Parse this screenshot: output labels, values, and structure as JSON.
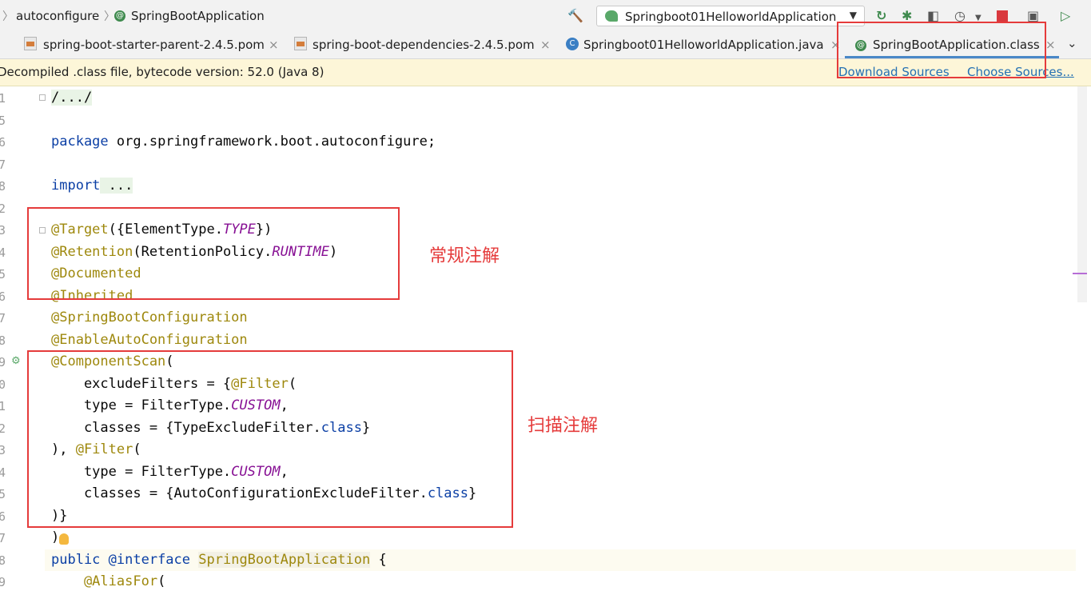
{
  "breadcrumb": {
    "items": [
      "autoconfigure",
      "SpringBootApplication"
    ]
  },
  "toolbar": {
    "run_config": "Springboot01HelloworldApplication",
    "icons": [
      "hammer-icon",
      "rerun-icon",
      "debug-icon",
      "coverage-icon",
      "profile-icon",
      "stop-icon",
      "project-structure-icon",
      "terminal-icon"
    ]
  },
  "tabs": [
    {
      "label": "spring-boot-starter-parent-2.4.5.pom",
      "close": "×",
      "icon": "maven-pom-icon"
    },
    {
      "label": "spring-boot-dependencies-2.4.5.pom",
      "close": "×",
      "icon": "maven-pom-icon"
    },
    {
      "label": "Springboot01HelloworldApplication.java",
      "close": "×",
      "icon": "java-class-icon"
    },
    {
      "label": "SpringBootApplication.class",
      "close": "×",
      "icon": "annotation-icon",
      "active": true
    }
  ],
  "banner": {
    "message": "Decompiled .class file, bytecode version: 52.0 (Java 8)",
    "download_sources": "Download Sources",
    "choose_sources": "Choose Sources..."
  },
  "gutter": {
    "line_numbers": [
      "1",
      "5",
      "6",
      "7",
      "8",
      "2",
      "3",
      "4",
      "5",
      "6",
      "7",
      "8",
      "9",
      "0",
      "1",
      "2",
      "3",
      "4",
      "5",
      "6",
      "7",
      "8",
      "9"
    ]
  },
  "code": {
    "l1": "/.../",
    "l2_kw": "package",
    "l2_rest": " org.springframework.boot.autoconfigure;",
    "l3_kw": "import",
    "l3_rest": " ...",
    "target_ann": "@Target",
    "target_a": "({ElementType.",
    "target_f": "TYPE",
    "target_b": "})",
    "retention_ann": "@Retention",
    "retention_a": "(RetentionPolicy.",
    "retention_f": "RUNTIME",
    "retention_b": ")",
    "documented": "@Documented",
    "inherited": "@Inherited",
    "sbc": "@SpringBootConfiguration",
    "eac": "@EnableAutoConfiguration",
    "cs_ann": "@ComponentScan",
    "cs_open": "(",
    "ef_a": "    excludeFilters = {",
    "ef_ann": "@Filter",
    "ef_b": "(",
    "type1_a": "    type = FilterType.",
    "type1_f": "CUSTOM",
    "type1_b": ",",
    "cls1_a": "    classes = {TypeExcludeFilter.",
    "cls1_kw": "class",
    "cls1_b": "}",
    "f2_a": "), ",
    "f2_ann": "@Filter",
    "f2_b": "(",
    "type2_a": "    type = FilterType.",
    "type2_f": "CUSTOM",
    "type2_b": ",",
    "cls2_a": "    classes = {AutoConfigurationExcludeFilter.",
    "cls2_kw": "class",
    "cls2_b": "}",
    "close_a": ")}",
    "close_b": ")",
    "decl_kw1": "public",
    "decl_kw2": " @interface",
    "decl_sp": " ",
    "decl_name": "SpringBootApplication",
    "decl_rest": " {",
    "alias_ann": "    @AliasFor",
    "alias_rest": "("
  },
  "notes": {
    "regular_annotations": "常规注解",
    "scan_annotations": "扫描注解"
  },
  "colors": {
    "highlight_box": "#e53b3b",
    "keyword": "#0b3fa5",
    "annotation": "#9e880d",
    "field": "#871094",
    "link": "#2470b3"
  }
}
